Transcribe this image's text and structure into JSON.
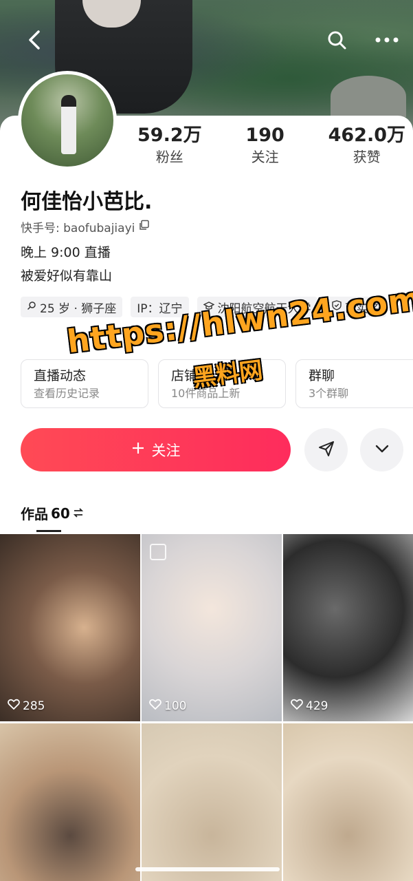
{
  "profile": {
    "name": "何佳怡小芭比.",
    "kuaishou_id_label": "快手号: baofubajiayi",
    "bio_lines": [
      "晚上 9:00 直播",
      "被爱好似有靠山"
    ]
  },
  "stats": [
    {
      "value": "59.2万",
      "label": "粉丝"
    },
    {
      "value": "190",
      "label": "关注"
    },
    {
      "value": "462.0万",
      "label": "获赞"
    }
  ],
  "tags": [
    "25 岁 · 狮子座",
    "IP：辽宁",
    "沈阳航空航天大学",
    "已实名"
  ],
  "cards": [
    {
      "title": "直播动态",
      "sub": "查看历史记录"
    },
    {
      "title": "店铺",
      "sub": "10件商品上新"
    },
    {
      "title": "群聊",
      "sub": "3个群聊"
    }
  ],
  "actions": {
    "follow_label": "关注"
  },
  "works": {
    "label": "作品",
    "count": "60"
  },
  "posts": [
    {
      "likes": "285"
    },
    {
      "likes": "100"
    },
    {
      "likes": "429"
    },
    {
      "likes": ""
    },
    {
      "likes": ""
    },
    {
      "likes": ""
    }
  ],
  "watermark": {
    "line1": "https://hlwn24.com",
    "line2": "黑料网"
  },
  "colors": {
    "accent": "#fe2c5c",
    "watermark": "#ffa51f"
  }
}
